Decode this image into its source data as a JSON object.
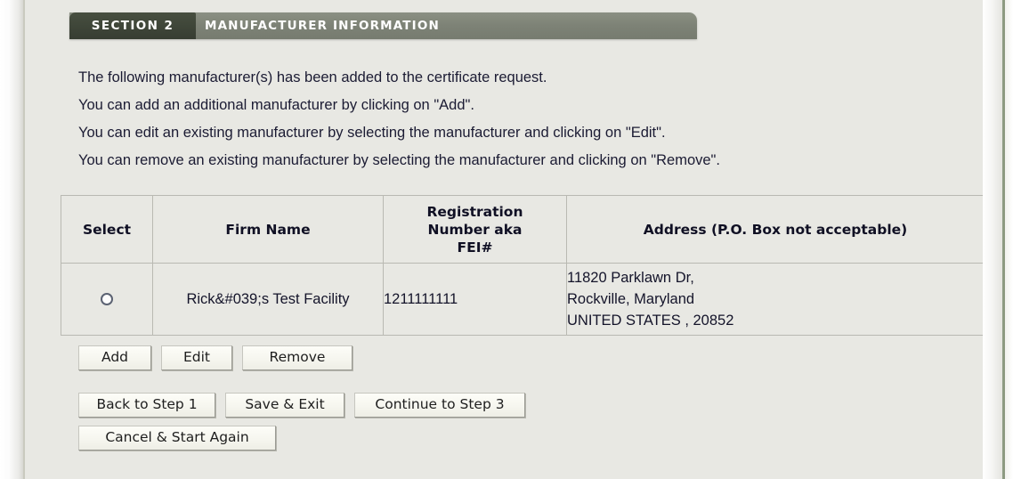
{
  "frame": {
    "background_color": "#e8e8e3",
    "border_accent_color": "#8d9a82"
  },
  "section_header": {
    "tab_label": "SECTION 2",
    "banner_label": "MANUFACTURER INFORMATION",
    "tab_color": "#3f4639",
    "banner_color": "#7e8377"
  },
  "intro": {
    "lines": [
      "The following manufacturer(s) has been added to the certificate request.",
      "You can add an additional manufacturer by clicking on \"Add\".",
      "You can edit an existing manufacturer by selecting the manufacturer and clicking on \"Edit\".",
      "You can remove an existing manufacturer by selecting the manufacturer and clicking on \"Remove\"."
    ]
  },
  "table": {
    "headers": {
      "select": "Select",
      "firm_name": "Firm Name",
      "registration_line1": "Registration",
      "registration_line2": "Number aka",
      "registration_line3": "FEI#",
      "address": "Address (P.O. Box not acceptable)"
    },
    "rows": [
      {
        "selected": false,
        "firm_name": "Rick&#039;s Test Facility",
        "registration_number": "1211111111",
        "address_line1": "11820 Parklawn Dr,",
        "address_line2": "Rockville, Maryland",
        "address_line3": "UNITED STATES , 20852"
      }
    ]
  },
  "buttons": {
    "add": "Add",
    "edit": "Edit",
    "remove": "Remove",
    "back_to_step_1": "Back to Step 1",
    "save_and_exit": "Save & Exit",
    "continue_to_step_3": "Continue to Step 3",
    "cancel_and_start_again": "Cancel & Start Again"
  }
}
